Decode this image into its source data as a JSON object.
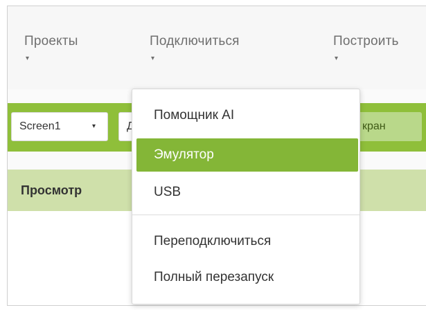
{
  "menubar": {
    "items": [
      {
        "label": "Проекты",
        "caret": "▾"
      },
      {
        "label": "Подключиться",
        "caret": "▾"
      },
      {
        "label": "Построить",
        "caret": "▾"
      }
    ]
  },
  "toolbar": {
    "screen_select": {
      "value": "Screen1",
      "arrow": "▾"
    },
    "add_screen_partial": "Д",
    "remove_screen_partial": "кран"
  },
  "viewer": {
    "title": "Просмотр"
  },
  "connect_menu": {
    "items": [
      {
        "label": "Помощник AI",
        "selected": false
      },
      {
        "label": "Эмулятор",
        "selected": true
      },
      {
        "label": "USB",
        "selected": false
      },
      {
        "label": "Переподключиться",
        "selected": false
      },
      {
        "label": "Полный перезапуск",
        "selected": false
      }
    ]
  },
  "colors": {
    "accent": "#84b637",
    "toolbar": "#8fbf3a",
    "viewer_header": "#cfe0aa"
  }
}
